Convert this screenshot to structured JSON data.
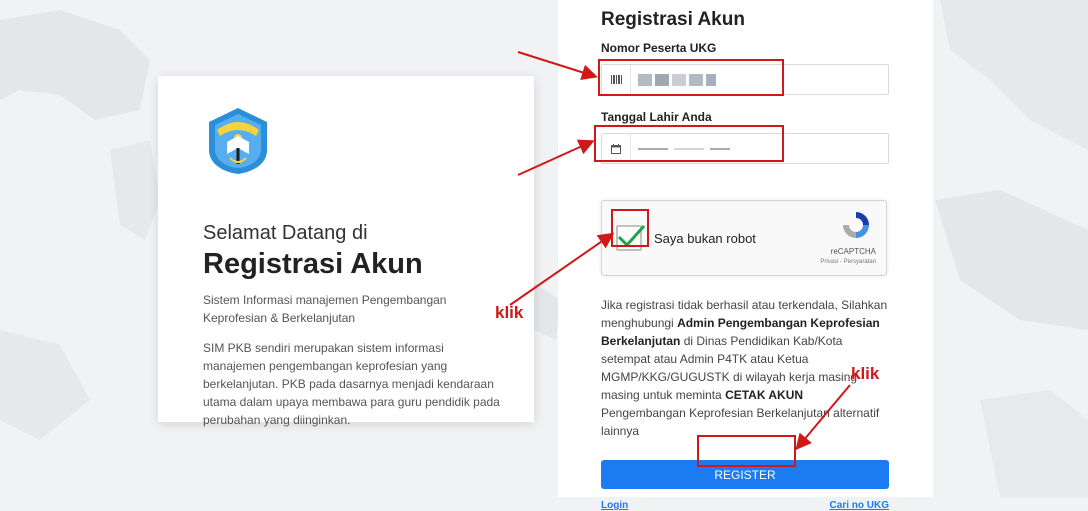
{
  "welcome": {
    "line1": "Selamat Datang di",
    "line2": "Registrasi Akun",
    "description1": "Sistem Informasi manajemen Pengembangan Keprofesian & Berkelanjutan",
    "description2": "SIM PKB sendiri merupakan sistem informasi manajemen pengembangan keprofesian yang berkelanjutan. PKB pada dasarnya menjadi kendaraan utama dalam upaya membawa para guru pendidik pada perubahan yang diinginkan."
  },
  "form": {
    "title": "Registrasi Akun",
    "nomor_label": "Nomor Peserta UKG",
    "nomor_value": "",
    "tanggal_label": "Tanggal Lahir Anda",
    "tanggal_value": ""
  },
  "recaptcha": {
    "label": "Saya bukan robot",
    "brand": "reCAPTCHA",
    "links": "Privasi - Persyaratan"
  },
  "info": {
    "part1": "Jika registrasi tidak berhasil atau terkendala, Silahkan menghubungi ",
    "bold1": "Admin Pengembangan Keprofesian Berkelanjutan",
    "part2": " di Dinas Pendidikan Kab/Kota setempat atau Admin P4TK atau Ketua MGMP/KKG/GUGUSTK di wilayah kerja masing-masing untuk meminta ",
    "bold2": "CETAK AKUN",
    "part3": " Pengembangan Keprofesian Berkelanjutan alternatif lainnya"
  },
  "buttons": {
    "register": "REGISTER",
    "login": "Login",
    "cari_ukg": "Cari no UKG"
  },
  "annotations": {
    "klik_left": "klik",
    "klik_right": "klik",
    "color": "#d01818"
  },
  "icons": {
    "nomor": "barcode-icon",
    "tanggal": "calendar-icon",
    "logo": "tut-wuri-handayani-logo",
    "recaptcha": "recaptcha-logo-icon",
    "check": "check-icon"
  },
  "colors": {
    "primary": "#1a7cf0",
    "annotation": "#d01818",
    "check": "#1fa34a"
  }
}
